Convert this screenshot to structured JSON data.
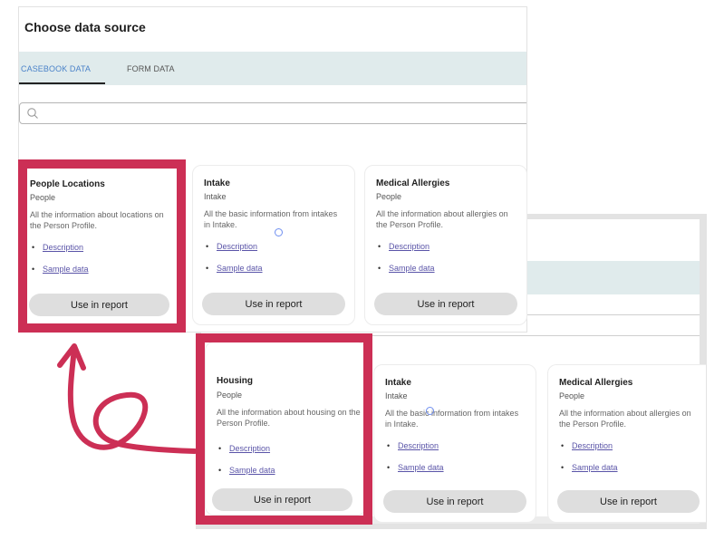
{
  "dialog": {
    "title": "Choose data source",
    "tabs": [
      {
        "label": "CASEBOOK DATA",
        "active": true
      },
      {
        "label": "FORM DATA",
        "active": false
      }
    ],
    "search": {
      "value": "",
      "placeholder": "",
      "icon": "search-icon"
    }
  },
  "top_cards": [
    {
      "name": "People Locations",
      "category": "People",
      "description": "All the information about locations on the Person Profile.",
      "links": [
        "Description",
        "Sample data"
      ],
      "button": "Use in report",
      "highlighted": true
    },
    {
      "name": "Intake",
      "category": "Intake",
      "description": "All the basic information from intakes in Intake.",
      "links": [
        "Description",
        "Sample data"
      ],
      "button": "Use in report",
      "highlighted": false
    },
    {
      "name": "Medical Allergies",
      "category": "People",
      "description": "All the information about allergies on the Person Profile.",
      "links": [
        "Description",
        "Sample data"
      ],
      "button": "Use in report",
      "highlighted": false
    }
  ],
  "bottom_cards": [
    {
      "name": "Housing",
      "category": "People",
      "description": "All the information about housing on the Person Profile.",
      "links": [
        "Description",
        "Sample data"
      ],
      "button": "Use in report",
      "highlighted": true
    },
    {
      "name": "Intake",
      "category": "Intake",
      "description": "All the basic information from intakes in Intake.",
      "links": [
        "Description",
        "Sample data"
      ],
      "button": "Use in report",
      "highlighted": false
    },
    {
      "name": "Medical Allergies",
      "category": "People",
      "description": "All the information about allergies on the Person Profile.",
      "links": [
        "Description",
        "Sample data"
      ],
      "button": "Use in report",
      "highlighted": false
    }
  ],
  "annotation": {
    "highlight_color": "#cc2f55",
    "arrow_icon": "curly-arrow-up-icon",
    "tab_active_color": "#4b83c9",
    "tabbar_color": "#e0ebec"
  }
}
